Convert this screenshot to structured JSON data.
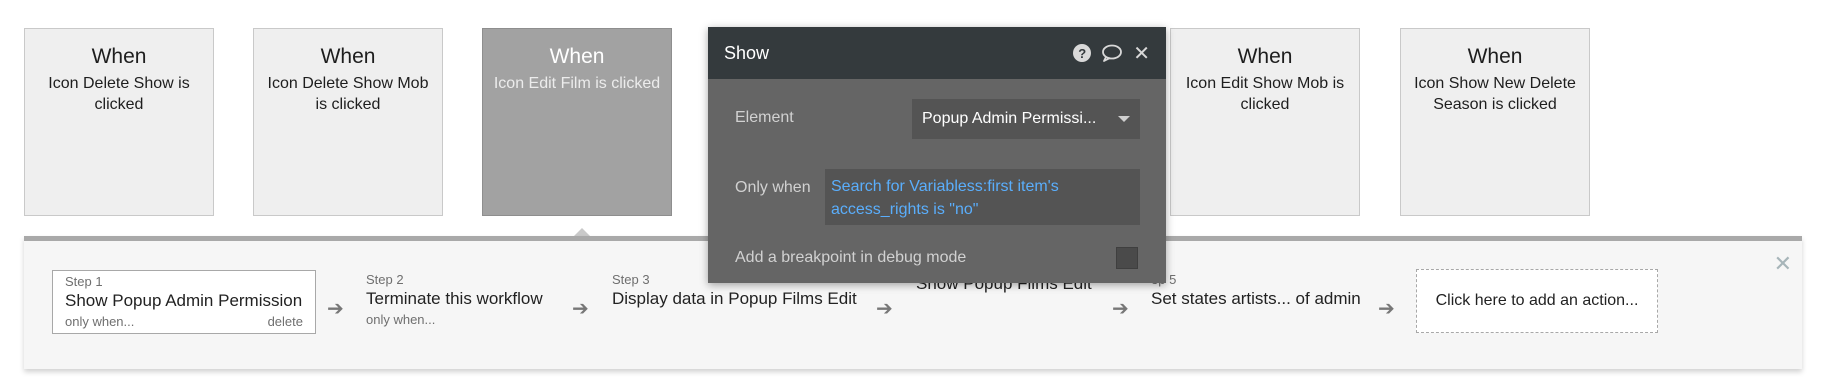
{
  "cards": [
    {
      "when": "When",
      "desc": "Icon Delete Show is clicked"
    },
    {
      "when": "When",
      "desc": "Icon Delete Show Mob is clicked"
    },
    {
      "when": "When",
      "desc": "Icon Edit Film is clicked"
    },
    {
      "when": "When",
      "desc": "Icon Edit Show Mob is clicked"
    },
    {
      "when": "When",
      "desc": "Icon Show New Delete Season is clicked"
    }
  ],
  "steps": [
    {
      "num": "Step 1",
      "title": "Show Popup Admin Permission",
      "sub": "only when...",
      "action": "delete"
    },
    {
      "num": "Step 2",
      "title": "Terminate this workflow",
      "sub": "only when..."
    },
    {
      "num": "Step 3",
      "title": "Display data in Popup Films Edit"
    },
    {
      "num": "",
      "title": "Show Popup Films Edit"
    },
    {
      "num": "ep 5",
      "title": "Set states artists... of admin"
    }
  ],
  "add_action": "Click here to add an action...",
  "dialog": {
    "title": "Show",
    "element_label": "Element",
    "element_value": "Popup Admin Permissi...",
    "only_when_label": "Only when",
    "only_when_value": "Search for Variabless:first item's access_rights is \"no\"",
    "breakpoint_label": "Add a breakpoint in debug mode"
  },
  "icons": {
    "help": "?",
    "comment": "comment-icon",
    "close": "✕",
    "arrow": "➔",
    "panel_close": "✕"
  },
  "colors": {
    "accent_link": "#5aaefc",
    "dialog_header": "#343a3d",
    "dialog_body": "#656565",
    "selected_card": "#a2a2a2"
  }
}
